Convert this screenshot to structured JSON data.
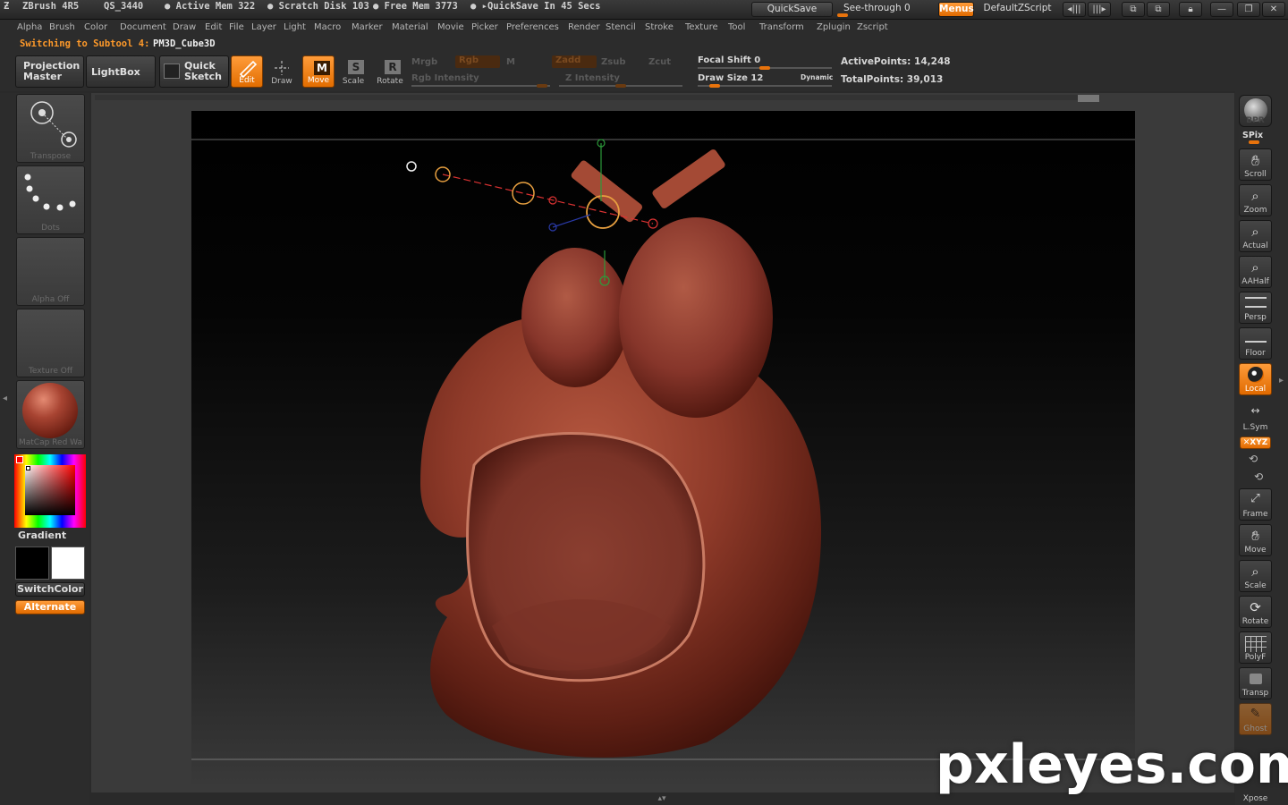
{
  "titlebar": {
    "app": "ZBrush 4R5",
    "doc": "QS_3440",
    "active_mem": "● Active Mem 322",
    "scratch": "● Scratch Disk 103",
    "free_mem": "● Free Mem 3773",
    "quicksave_timer": "● ▸QuickSave In 45 Secs",
    "quicksave_btn": "QuickSave",
    "seethrough": "See-through  0",
    "menus_btn": "Menus",
    "script": "DefaultZScript"
  },
  "menus": [
    "Alpha",
    "Brush",
    "Color",
    "Document",
    "Draw",
    "Edit",
    "File",
    "Layer",
    "Light",
    "Macro",
    "Marker",
    "Material",
    "Movie",
    "Picker",
    "Preferences",
    "Render",
    "Stencil",
    "Stroke",
    "Texture",
    "Tool",
    "Transform",
    "Zplugin",
    "Zscript"
  ],
  "status": {
    "message": "Switching to Subtool 4:",
    "tool_name": "PM3D_Cube3D"
  },
  "shelf": {
    "projection_master": [
      "Projection",
      "Master"
    ],
    "lightbox": "LightBox",
    "quick_sketch": [
      "Quick",
      "Sketch"
    ],
    "edit": "Edit",
    "draw": "Draw",
    "move": "Move",
    "scale": "Scale",
    "rotate": "Rotate",
    "mrgb": "Mrgb",
    "rgb": "Rgb",
    "m": "M",
    "zadd": "Zadd",
    "zsub": "Zsub",
    "zcut": "Zcut",
    "rgb_intensity": "Rgb Intensity",
    "z_intensity": "Z Intensity",
    "focal_shift": "Focal Shift 0",
    "draw_size": "Draw Size 12",
    "dynamic": "Dynamic",
    "active_points": "ActivePoints: 14,248",
    "total_points": "TotalPoints: 39,013"
  },
  "left": {
    "transpose": "Transpose",
    "dots": "Dots",
    "alpha": "Alpha  Off",
    "texture": "Texture  Off",
    "matcap": "MatCap  Red  Wa",
    "gradient": "Gradient",
    "switch_color": "SwitchColor",
    "alternate": "Alternate"
  },
  "right": {
    "bpr": "BPR",
    "spix": "SPix",
    "scroll": "Scroll",
    "zoom": "Zoom",
    "actual": "Actual",
    "aahalf": "AAHalf",
    "persp": "Persp",
    "floor": "Floor",
    "local": "Local",
    "lsym": "L.Sym",
    "xyz": "✕XYZ",
    "frame": "Frame",
    "move": "Move",
    "scale": "Scale",
    "rotate": "Rotate",
    "polyf": "PolyF",
    "transp": "Transp",
    "ghost": "Ghost",
    "xpose": "Xpose"
  },
  "watermark": "pxleyes.com",
  "colors": {
    "accent": "#ff8a1a",
    "clay": "#8a3628"
  }
}
